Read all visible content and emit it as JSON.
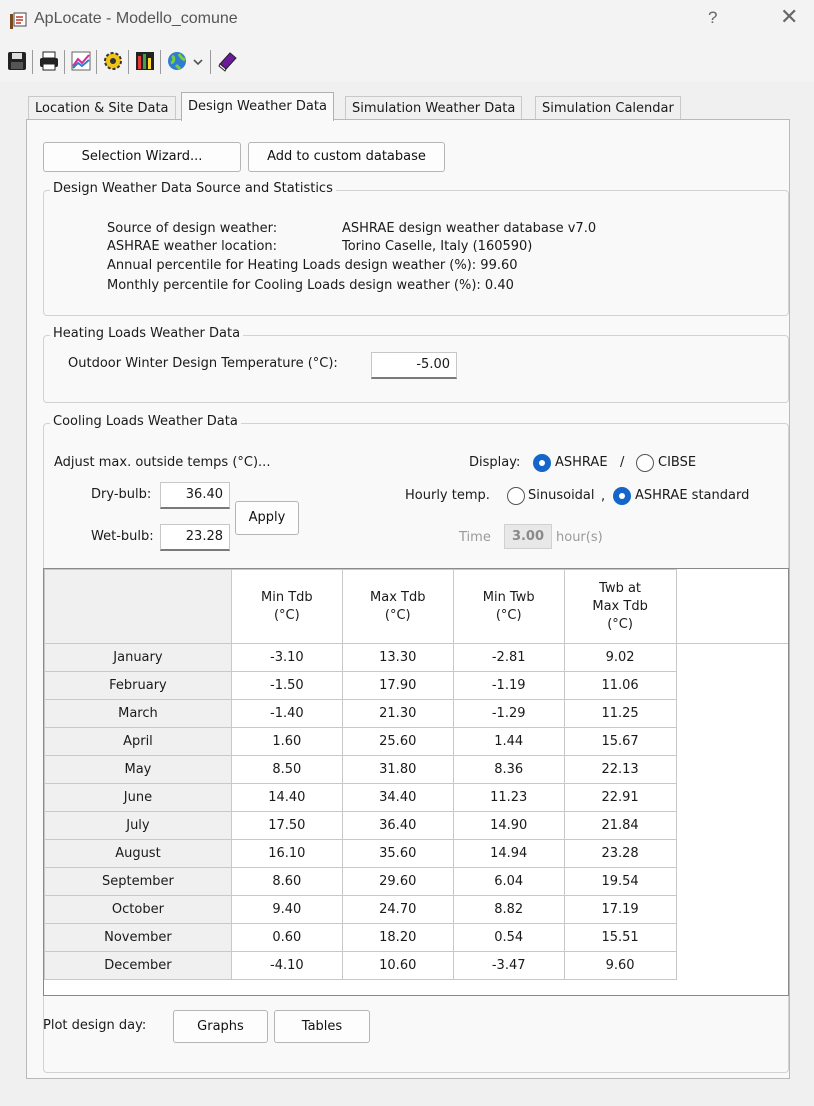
{
  "window": {
    "title": "ApLocate - Modello_comune",
    "help_glyph": "?",
    "close_glyph": "✕"
  },
  "toolbar": {
    "icons": [
      "save-icon",
      "print-icon",
      "graph-icon",
      "settings-icon",
      "chart-bars-icon",
      "globe-icon",
      "chevron-down-icon",
      "book-icon"
    ]
  },
  "tabs": [
    "Location & Site Data",
    "Design Weather Data",
    "Simulation Weather Data",
    "Simulation Calendar"
  ],
  "active_tab": 1,
  "buttons": {
    "selection_wizard": "Selection Wizard...",
    "add_custom_db": "Add to custom database",
    "apply": "Apply",
    "graphs": "Graphs",
    "tables": "Tables"
  },
  "source_group": {
    "title": "Design Weather Data Source and Statistics",
    "source_label": "Source of design weather:",
    "source_value": "ASHRAE design weather database v7.0",
    "location_label": "ASHRAE weather location:",
    "location_value": "Torino Caselle, Italy (160590)",
    "heating_pct_line": "Annual percentile for Heating Loads design weather (%):  99.60",
    "cooling_pct_line": "Monthly percentile for Cooling Loads design weather (%): 0.40"
  },
  "heating_group": {
    "title": "Heating Loads Weather Data",
    "winter_label": "Outdoor Winter Design Temperature (°C):",
    "winter_value": "-5.00"
  },
  "cooling_group": {
    "title": "Cooling Loads Weather Data",
    "adjust_label": "Adjust max. outside temps (°C)...",
    "dry_label": "Dry-bulb:",
    "dry_value": "36.40",
    "wet_label": "Wet-bulb:",
    "wet_value": "23.28",
    "display_label": "Display:",
    "display_ashrae": "ASHRAE",
    "display_sep": "/",
    "display_cibse": "CIBSE",
    "display_selected": "ASHRAE",
    "hourly_label": "Hourly temp.",
    "hourly_sinusoidal": "Sinusoidal",
    "hourly_sep": ",",
    "hourly_ashrae": "ASHRAE standard",
    "hourly_selected": "ASHRAE standard",
    "time_label": "Time",
    "time_value": "3.00",
    "time_unit": "hour(s)"
  },
  "table": {
    "headers": [
      [
        "Min Tdb",
        "(°C)"
      ],
      [
        "Max Tdb",
        "(°C)"
      ],
      [
        "Min Twb",
        "(°C)"
      ],
      [
        "Twb at",
        "Max Tdb",
        "(°C)"
      ]
    ],
    "rows": [
      [
        "January",
        "-3.10",
        "13.30",
        "-2.81",
        "9.02"
      ],
      [
        "February",
        "-1.50",
        "17.90",
        "-1.19",
        "11.06"
      ],
      [
        "March",
        "-1.40",
        "21.30",
        "-1.29",
        "11.25"
      ],
      [
        "April",
        "1.60",
        "25.60",
        "1.44",
        "15.67"
      ],
      [
        "May",
        "8.50",
        "31.80",
        "8.36",
        "22.13"
      ],
      [
        "June",
        "14.40",
        "34.40",
        "11.23",
        "22.91"
      ],
      [
        "July",
        "17.50",
        "36.40",
        "14.90",
        "21.84"
      ],
      [
        "August",
        "16.10",
        "35.60",
        "14.94",
        "23.28"
      ],
      [
        "September",
        "8.60",
        "29.60",
        "6.04",
        "19.54"
      ],
      [
        "October",
        "9.40",
        "24.70",
        "8.82",
        "17.19"
      ],
      [
        "November",
        "0.60",
        "18.20",
        "0.54",
        "15.51"
      ],
      [
        "December",
        "-4.10",
        "10.60",
        "-3.47",
        "9.60"
      ]
    ]
  },
  "plot": {
    "label": "Plot design day:"
  }
}
